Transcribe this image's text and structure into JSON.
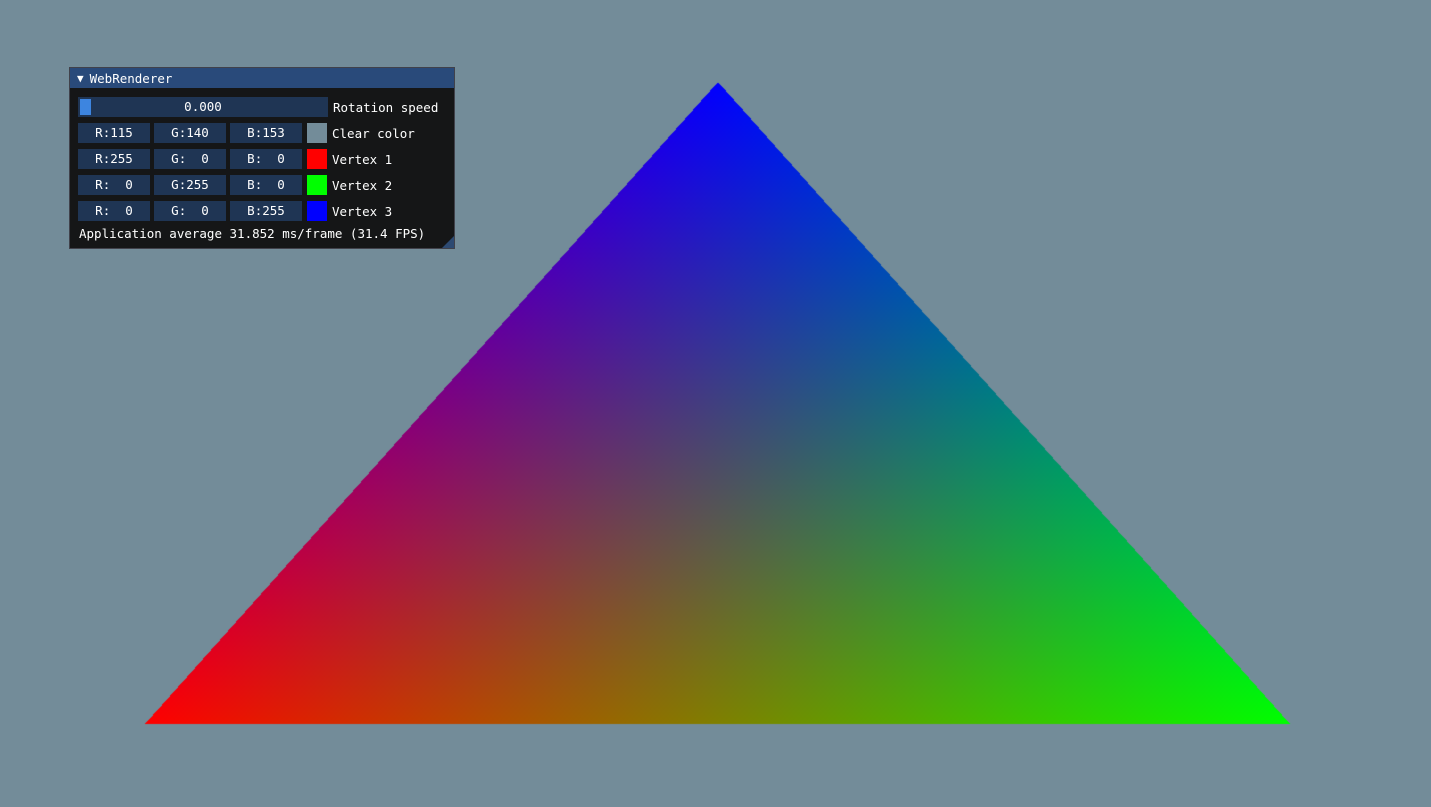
{
  "window": {
    "title": "WebRenderer",
    "collapse_glyph": "▼",
    "rotation": {
      "value": "0.000",
      "fraction": 0.0,
      "label": "Rotation speed"
    },
    "color_rows": [
      {
        "r": "R:115",
        "g": "G:140",
        "b": "B:153",
        "label": "Clear color",
        "color": "#738c99"
      },
      {
        "r": "R:255",
        "g": "G:  0",
        "b": "B:  0",
        "label": "Vertex 1",
        "color": "#ff0000"
      },
      {
        "r": "R:  0",
        "g": "G:255",
        "b": "B:  0",
        "label": "Vertex 2",
        "color": "#00ff00"
      },
      {
        "r": "R:  0",
        "g": "G:  0",
        "b": "B:255",
        "label": "Vertex 3",
        "color": "#0000ff"
      }
    ],
    "status": "Application average 31.852 ms/frame (31.4 FPS)"
  },
  "scene": {
    "clear_color": "#738c99",
    "triangle": {
      "vertex_colors": [
        "#ff0000",
        "#00ff00",
        "#0000ff"
      ]
    }
  }
}
